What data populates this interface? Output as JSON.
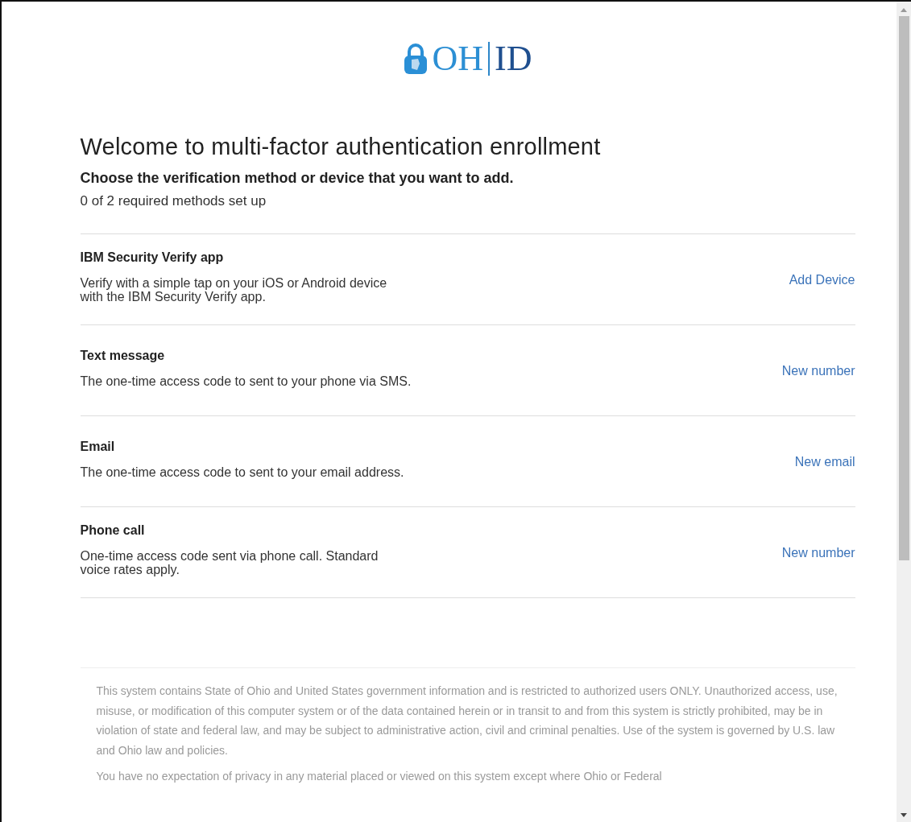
{
  "logo": {
    "left": "OH",
    "right": "ID"
  },
  "title": "Welcome to multi-factor authentication enrollment",
  "subtitle": "Choose the verification method or device that you want to add.",
  "progress": "0 of 2 required methods set up",
  "methods": [
    {
      "name": "IBM Security Verify app",
      "description": [
        "Verify with a simple tap on your iOS or Android device",
        "with the IBM Security Verify app."
      ],
      "action": "Add Device"
    },
    {
      "name": "Text message",
      "description": [
        "The one-time access code to sent to your phone via SMS."
      ],
      "action": "New number"
    },
    {
      "name": "Email",
      "description": [
        "The one-time access code to sent to your email address."
      ],
      "action": "New email"
    },
    {
      "name": "Phone call",
      "description": [
        "One-time access code sent via phone call. Standard",
        "voice rates apply."
      ],
      "action": "New number"
    }
  ],
  "notice": [
    "This system contains State of Ohio and United States government information and is restricted to authorized users ONLY. Unauthorized access, use, misuse, or modification of this computer system or of the data contained herein or in transit to and from this system is strictly prohibited, may be in violation of state and federal law, and may be subject to administrative action, civil and criminal penalties. Use of the system is governed by U.S. law and Ohio law and policies.",
    "You have no expectation of privacy in any material placed or viewed on this system except where Ohio or Federal"
  ]
}
